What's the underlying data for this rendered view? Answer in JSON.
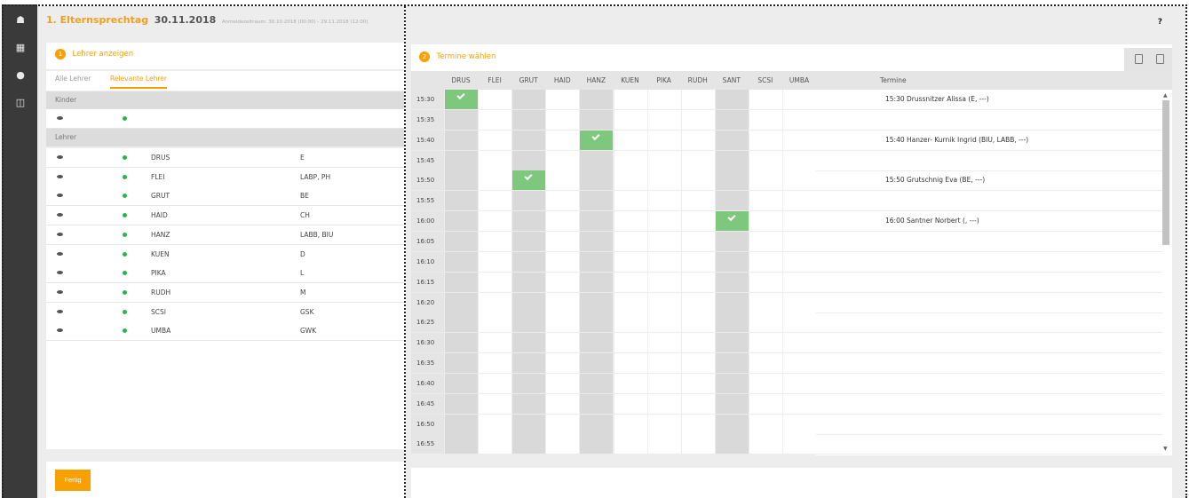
{
  "header": {
    "title": "1. Elternsprechtag",
    "date": "30.11.2018",
    "subtitle": "Anmeldezeitraum: 30.10.2018 (00:00) - 29.11.2018 (12:00)",
    "help": "?"
  },
  "sidebar": {
    "icons": [
      "dashboard-icon",
      "calendar-icon",
      "chat-icon",
      "book-icon"
    ]
  },
  "left_panel": {
    "badge": "1",
    "title": "Lehrer anzeigen",
    "tabs": [
      {
        "label": "Alle Lehrer",
        "active": false
      },
      {
        "label": "Relevante Lehrer",
        "active": true
      }
    ],
    "kinder_label": "Kinder",
    "lehrer_label": "Lehrer",
    "teachers": [
      {
        "code": "DRUS",
        "subjects": "E"
      },
      {
        "code": "FLEI",
        "subjects": "LABP, PH"
      },
      {
        "code": "GRUT",
        "subjects": "BE"
      },
      {
        "code": "HAID",
        "subjects": "CH"
      },
      {
        "code": "HANZ",
        "subjects": "LABB, BIU"
      },
      {
        "code": "KUEN",
        "subjects": "D"
      },
      {
        "code": "PIKA",
        "subjects": "L"
      },
      {
        "code": "RUDH",
        "subjects": "M"
      },
      {
        "code": "SCSI",
        "subjects": "GSK"
      },
      {
        "code": "UMBA",
        "subjects": "GWK"
      }
    ],
    "done_button": "Fertig"
  },
  "right_panel": {
    "badge": "2",
    "title": "Termine wählen",
    "icons": [
      "pdf-icon",
      "print-icon"
    ],
    "columns": [
      "DRUS",
      "FLEI",
      "GRUT",
      "HAID",
      "HANZ",
      "KUEN",
      "PIKA",
      "RUDH",
      "SANT",
      "SCSI",
      "UMBA"
    ],
    "termine_header": "Termine",
    "times": [
      "15:30",
      "15:35",
      "15:40",
      "15:45",
      "15:50",
      "15:55",
      "16:00",
      "16:05",
      "16:10",
      "16:15",
      "16:20",
      "16:25",
      "16:30",
      "16:35",
      "16:40",
      "16:45",
      "16:50",
      "16:55"
    ],
    "available_columns": [
      "DRUS",
      "GRUT",
      "HANZ",
      "SANT"
    ],
    "booked": [
      {
        "time": "15:30",
        "teacher": "DRUS"
      },
      {
        "time": "15:40",
        "teacher": "HANZ"
      },
      {
        "time": "15:50",
        "teacher": "GRUT"
      },
      {
        "time": "16:00",
        "teacher": "SANT"
      }
    ],
    "appointments": [
      {
        "time": "15:30",
        "text": "15:30 Drussnitzer Alissa (E, ---)"
      },
      {
        "time": "15:40",
        "text": "15:40 Hanzer- Kurnik Ingrid (BIU, LABB, ---)"
      },
      {
        "time": "15:50",
        "text": "15:50 Grutschnig Eva (BE, ---)"
      },
      {
        "time": "16:00",
        "text": "16:00 Santner Norbert (, ---)"
      }
    ]
  }
}
